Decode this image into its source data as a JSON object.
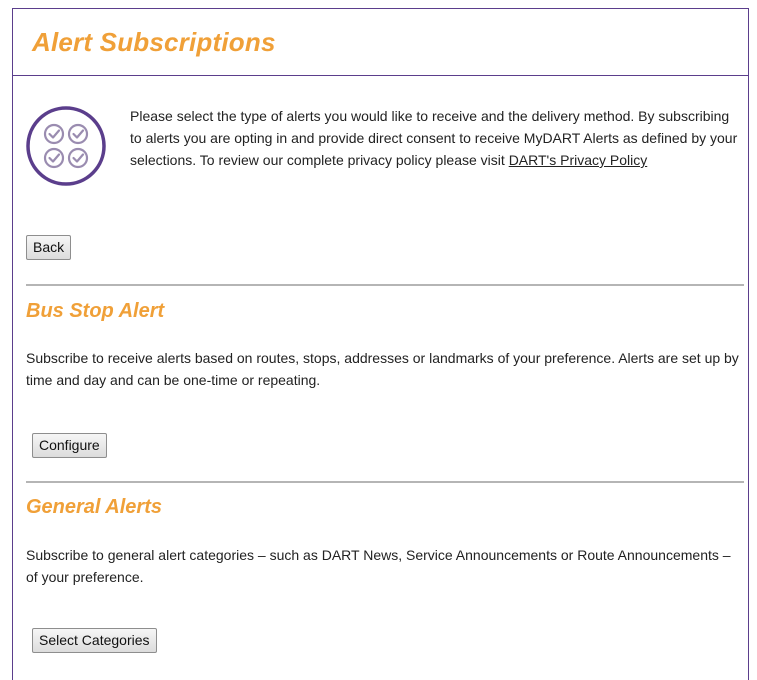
{
  "header": {
    "title": "Alert Subscriptions"
  },
  "intro": {
    "text": "Please select the type of alerts you would like to receive and the delivery method. By subscribing to alerts you are opting in and provide direct consent to receive MyDART Alerts as defined by your selections. To review our complete privacy policy please visit",
    "privacy_link": "DART's Privacy Policy",
    "icon": "checklist-circle-icon"
  },
  "back_button": "Back",
  "sections": [
    {
      "title": "Bus Stop Alert",
      "description": "Subscribe to receive alerts based on routes, stops, addresses or landmarks of your preference. Alerts are set up by time and day and can be one-time or repeating.",
      "button": "Configure"
    },
    {
      "title": "General Alerts",
      "description": "Subscribe to general alert categories – such as DART News, Service Announcements or Route Announcements – of your preference.",
      "button": "Select Categories"
    }
  ],
  "colors": {
    "accent": "#f0a038",
    "border": "#5b3e8c",
    "divider": "#b5b5b5"
  }
}
